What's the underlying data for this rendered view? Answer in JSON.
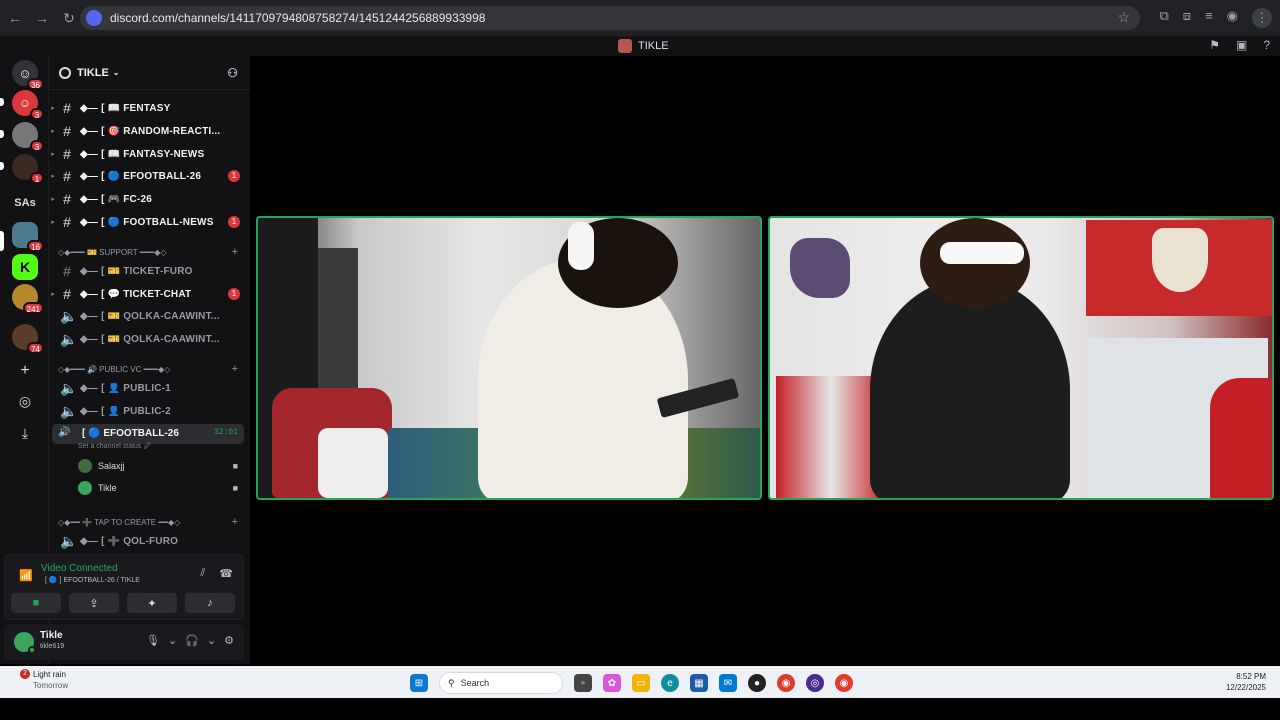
{
  "browser": {
    "url": "discord.com/channels/1411709794808758274/1451244256889933998"
  },
  "window": {
    "title": "TIKLE"
  },
  "rail": {
    "badges": [
      "36",
      "3",
      "3",
      "1",
      "16",
      "241",
      "74"
    ],
    "text_server": "SAs"
  },
  "server": {
    "name": "TIKLE"
  },
  "channels": [
    {
      "name": "◆— [ 📖 FENTASY",
      "unread": true
    },
    {
      "name": "◆— [ 🎯 RANDOM-REACTI...",
      "unread": true
    },
    {
      "name": "◆— [ 📖 FANTASY-NEWS",
      "unread": true
    },
    {
      "name": "◆— [ 🔵 EFOOTBALL-26",
      "unread": true,
      "count": "1"
    },
    {
      "name": "◆— [ 🎮 FC-26",
      "unread": true
    },
    {
      "name": "◆— [ 🔵 FOOTBALL-NEWS",
      "unread": true,
      "count": "1"
    }
  ],
  "support_category": "◇◆━━━ 🎫 SUPPORT ━━━◆◇",
  "support_channels": [
    {
      "name": "◆— [ 🎫 TICKET-FURO",
      "unread": false
    },
    {
      "name": "◆— [ 💬 TICKET-CHAT",
      "unread": true,
      "count": "1"
    },
    {
      "name": "◆— [ 🎫 QOLKA-CAAWINT...",
      "unread": false
    },
    {
      "name": "◆— [ 🎫 QOLKA-CAAWINT...",
      "unread": false
    }
  ],
  "public_category": "◇◆━━━ 🔊 PUBLIC VC ━━━◆◇",
  "public_channels": [
    {
      "name": "◆— [ 👤 PUBLIC-1"
    },
    {
      "name": "◆— [ 👤 PUBLIC-2"
    }
  ],
  "active_vc": {
    "name": "[ 🔵 EFOOTBALL-26",
    "timer": "32:01",
    "status": "Set a channel status 🖉",
    "members": [
      "Salaxjj",
      "Tikle"
    ]
  },
  "create_category": "◇◆━━ ➕ TAP TO CREATE ━━◆◇",
  "create_channel": "◆— [ ➕ QOL-FURO",
  "voice_panel": {
    "status": "Video Connected",
    "sub": "[ 🔵 ] EFOOTBALL-26 / TIKLE"
  },
  "user": {
    "name": "Tikle",
    "tag": "tikle619"
  },
  "taskbar": {
    "weather_badge": "2",
    "weather_line1": "Light rain",
    "weather_line2": "Tomorrow",
    "search_placeholder": "Search",
    "time": "8:52 PM",
    "date": "12/22/2025"
  },
  "colors": {
    "discord_green": "#23a55a",
    "mention_red": "#da373c",
    "blurple": "#5865f2"
  }
}
